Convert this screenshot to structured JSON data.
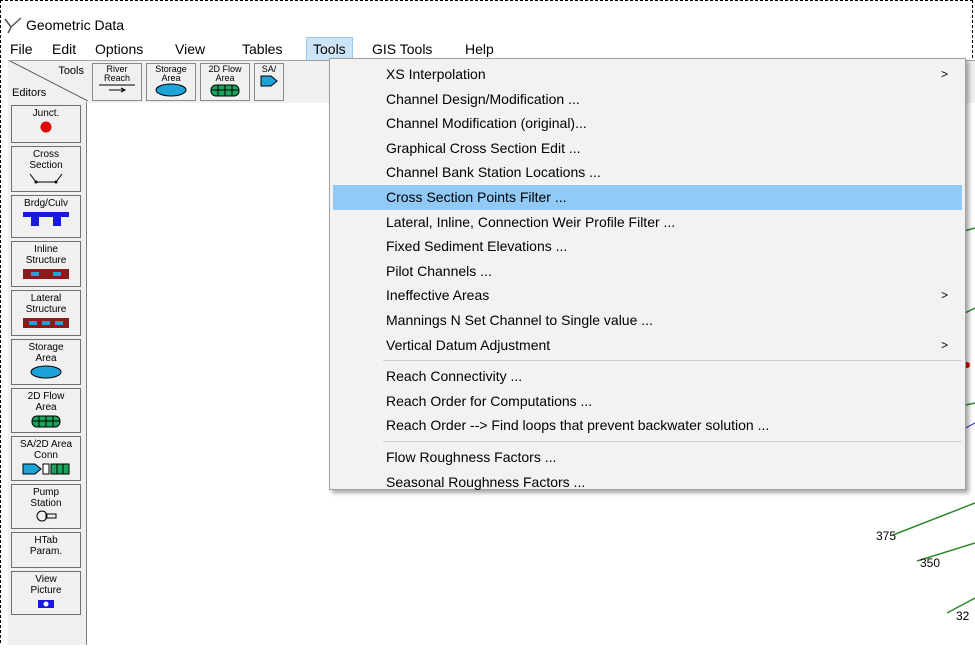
{
  "window": {
    "title": "Geometric Data"
  },
  "menubar": {
    "items": [
      "File",
      "Edit",
      "Options",
      "View",
      "Tables",
      "Tools",
      "GIS Tools",
      "Help"
    ]
  },
  "toolbar": {
    "tools_label": "Tools",
    "editors_label": "Editors",
    "buttons": [
      {
        "label": "River\nReach"
      },
      {
        "label": "Storage\nArea"
      },
      {
        "label": "2D Flow\nArea"
      },
      {
        "label": "SA/"
      }
    ]
  },
  "sidebar": {
    "items": [
      {
        "label": "Junct."
      },
      {
        "label": "Cross\nSection"
      },
      {
        "label": "Brdg/Culv"
      },
      {
        "label": "Inline\nStructure"
      },
      {
        "label": "Lateral\nStructure"
      },
      {
        "label": "Storage\nArea"
      },
      {
        "label": "2D Flow\nArea"
      },
      {
        "label": "SA/2D Area\nConn"
      },
      {
        "label": "Pump\nStation"
      },
      {
        "label": "HTab\nParam."
      },
      {
        "label": "View\nPicture"
      }
    ]
  },
  "tools_menu": {
    "groups": [
      [
        {
          "label": "XS Interpolation",
          "submenu": true
        },
        {
          "label": "Channel Design/Modification ..."
        },
        {
          "label": "Channel Modification (original)..."
        },
        {
          "label": "Graphical Cross Section Edit ..."
        },
        {
          "label": "Channel Bank Station Locations ..."
        },
        {
          "label": "Cross Section Points Filter ...",
          "highlighted": true
        },
        {
          "label": "Lateral, Inline, Connection Weir Profile Filter ..."
        },
        {
          "label": "Fixed Sediment Elevations ..."
        },
        {
          "label": "Pilot Channels ..."
        },
        {
          "label": "Ineffective Areas",
          "submenu": true
        },
        {
          "label": "Mannings N Set Channel to Single value ..."
        },
        {
          "label": "Vertical Datum Adjustment",
          "submenu": true
        }
      ],
      [
        {
          "label": "Reach Connectivity ..."
        },
        {
          "label": "Reach Order for Computations ..."
        },
        {
          "label": "Reach Order --> Find loops that prevent backwater solution ..."
        }
      ],
      [
        {
          "label": "Flow Roughness Factors ..."
        },
        {
          "label": "Seasonal Roughness Factors ..."
        }
      ]
    ],
    "submenu_arrow": ">"
  },
  "canvas": {
    "station_labels": [
      "375",
      "350",
      "32"
    ],
    "line_color": "#2e8b2e"
  }
}
